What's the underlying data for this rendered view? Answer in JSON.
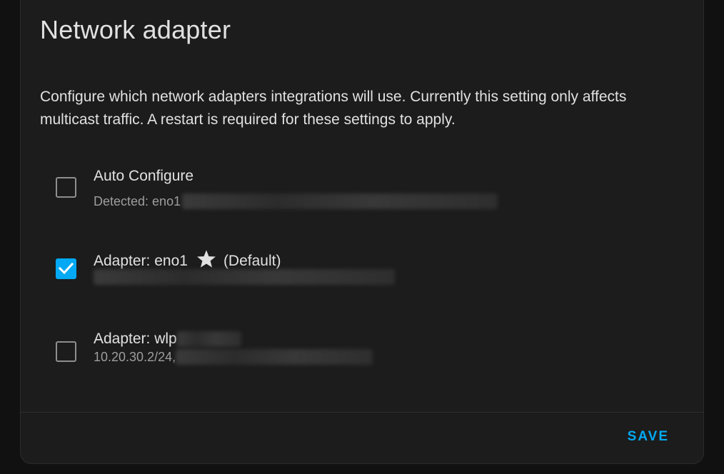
{
  "dialog": {
    "title": "Network adapter",
    "description": "Configure which network adapters integrations will use. Currently this setting only affects multicast traffic. A restart is required for these settings to apply.",
    "save_label": "SAVE"
  },
  "adapters": [
    {
      "label": "Auto Configure",
      "sub_prefix": "Detected: eno1",
      "checked": false
    },
    {
      "label_prefix": "Adapter: eno1",
      "label_suffix": "(Default)",
      "icon": "star-icon",
      "checked": true
    },
    {
      "label_prefix": "Adapter: wlp",
      "sub_prefix": "10.20.30.2/24,",
      "checked": false
    }
  ],
  "colors": {
    "accent": "#03a9f4",
    "background": "#1c1c1c",
    "text_primary": "#e1e1e1",
    "text_secondary": "#9e9e9e"
  }
}
